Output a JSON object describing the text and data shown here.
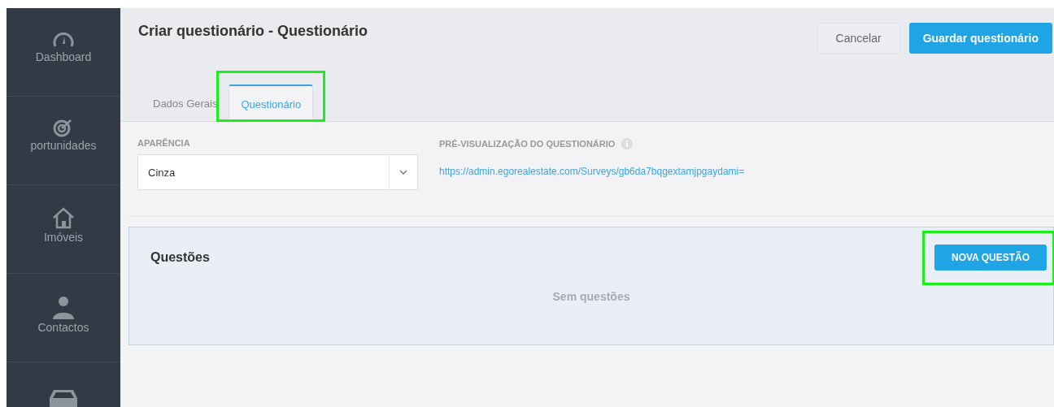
{
  "sidebar": {
    "items": [
      {
        "kind": "gauge",
        "label": "Dashboard"
      },
      {
        "kind": "target",
        "label": "portunidades"
      },
      {
        "kind": "house",
        "label": "Imóveis"
      },
      {
        "kind": "person",
        "label": "Contactos"
      },
      {
        "kind": "inbox"
      }
    ]
  },
  "header": {
    "title": "Criar questionário - Questionário",
    "buttons": [
      {
        "label": "Cancelar",
        "kind": "secondary"
      },
      {
        "label": "Guardar questionário",
        "kind": "primary"
      }
    ]
  },
  "tabs": [
    {
      "label": "Dados Gerais",
      "selected": false,
      "highlighted": false
    },
    {
      "label": "Questionário",
      "selected": true,
      "highlighted": true
    }
  ],
  "appearance": {
    "label": "APARÊNCIA",
    "value": "Cinza"
  },
  "preview": {
    "label": "PRÉ-VISUALIZAÇÃO DO QUESTIONÁRIO",
    "url": "https://admin.egorealestate.com/Surveys/gb6da7bqgextamjpgaydami="
  },
  "questions": {
    "title": "Questões",
    "button": {
      "label": "NOVA QUESTÃO",
      "highlighted": true
    },
    "empty": "Sem questões"
  }
}
